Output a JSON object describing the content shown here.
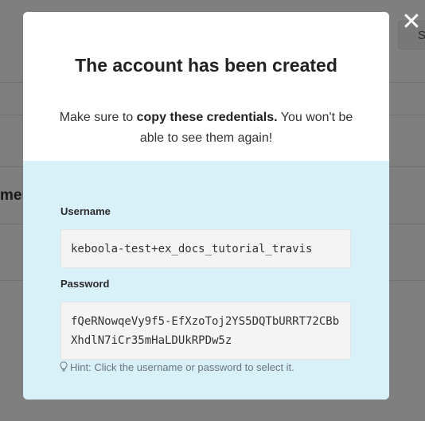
{
  "background": {
    "heading_fragment": "men",
    "button_fragment": "S"
  },
  "modal": {
    "title": "The account has been created",
    "description_prefix": "Make sure to ",
    "description_bold": "copy these credentials.",
    "description_suffix": " You won't be able to see them again!",
    "username_label": "Username",
    "username_value": "keboola-test+ex_docs_tutorial_travis",
    "password_label": "Password",
    "password_value": "fQeRNowqeVy9f5-EfXzoToj2YS5DQTbURRT72CBbXhdlN7iCr35mHaLDUkRPDw5z",
    "hint": "Hint: Click the username or password to select it.",
    "close_icon": "close-icon",
    "hint_icon": "lightbulb-icon"
  },
  "colors": {
    "backdrop": "rgba(0,0,0,0.5)",
    "credentials_bg": "#d8f0f8",
    "field_bg": "#f4f4f4"
  }
}
